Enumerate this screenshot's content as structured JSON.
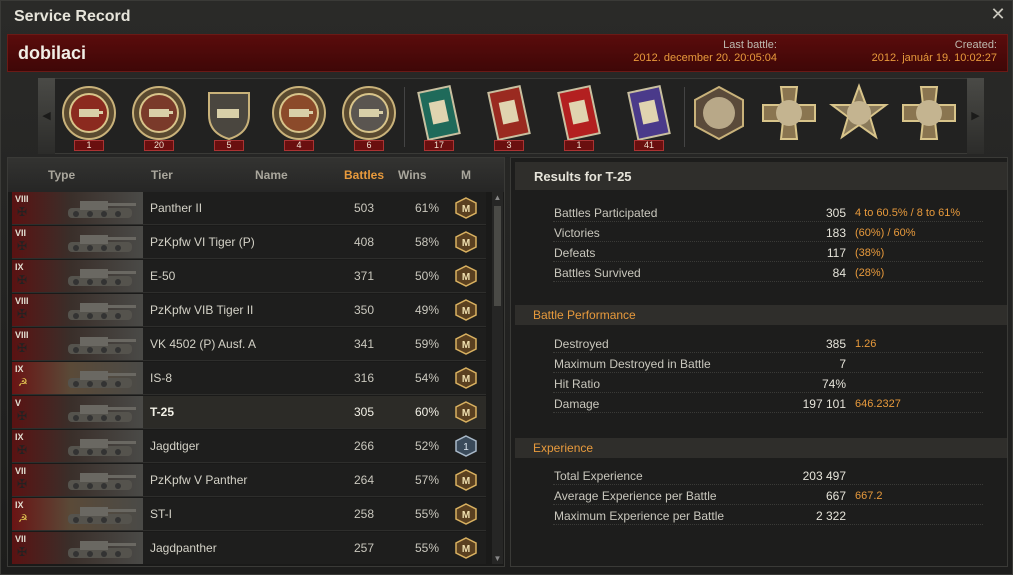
{
  "window": {
    "title": "Service Record",
    "close_icon": "close-icon"
  },
  "player": {
    "name": "dobilaci",
    "last_battle_label": "Last battle:",
    "last_battle": "2012. december 20. 20:05:04",
    "created_label": "Created:",
    "created": "2012. január 19. 10:02:27"
  },
  "medals": [
    {
      "icon": "tank-medal-icon",
      "count": "1"
    },
    {
      "icon": "sniper-medal-icon",
      "count": "20"
    },
    {
      "icon": "tank-shield-medal-icon",
      "count": "5"
    },
    {
      "icon": "tank-wreath-medal-icon",
      "count": "4"
    },
    {
      "icon": "sword-shield-medal-icon",
      "count": "6"
    },
    {
      "icon": "green-ribbon-medal-icon",
      "count": "17"
    },
    {
      "icon": "red-ribbon-medal-icon",
      "count": "3"
    },
    {
      "icon": "red-star-ribbon-medal-icon",
      "count": "1"
    },
    {
      "icon": "blue-ribbon-medal-icon",
      "count": "41"
    },
    {
      "icon": "hexagon-portrait-medal-icon",
      "count": ""
    },
    {
      "icon": "cross-portrait-medal-icon",
      "count": ""
    },
    {
      "icon": "star-portrait-medal-icon",
      "count": ""
    },
    {
      "icon": "cross-portrait-gold-medal-icon",
      "count": ""
    }
  ],
  "table": {
    "headers": {
      "type": "Type",
      "tier": "Tier",
      "name": "Name",
      "battles": "Battles",
      "wins": "Wins",
      "mastery": "M"
    },
    "rows": [
      {
        "tier": "VIII",
        "name": "Panther II",
        "battles": "503",
        "wins": "61%",
        "mastery": "M",
        "nation": "de",
        "selected": false
      },
      {
        "tier": "VII",
        "name": "PzKpfw VI Tiger (P)",
        "battles": "408",
        "wins": "58%",
        "mastery": "M",
        "nation": "de",
        "selected": false
      },
      {
        "tier": "IX",
        "name": "E-50",
        "battles": "371",
        "wins": "50%",
        "mastery": "M",
        "nation": "de",
        "selected": false
      },
      {
        "tier": "VIII",
        "name": "PzKpfw VIB Tiger II",
        "battles": "350",
        "wins": "49%",
        "mastery": "M",
        "nation": "de",
        "selected": false
      },
      {
        "tier": "VIII",
        "name": "VK 4502 (P) Ausf. A",
        "battles": "341",
        "wins": "59%",
        "mastery": "M",
        "nation": "de",
        "selected": false
      },
      {
        "tier": "IX",
        "name": "IS-8",
        "battles": "316",
        "wins": "54%",
        "mastery": "M",
        "nation": "ussr",
        "selected": false
      },
      {
        "tier": "V",
        "name": "T-25",
        "battles": "305",
        "wins": "60%",
        "mastery": "M",
        "nation": "de",
        "selected": true
      },
      {
        "tier": "IX",
        "name": "Jagdtiger",
        "battles": "266",
        "wins": "52%",
        "mastery": "1",
        "nation": "de",
        "selected": false
      },
      {
        "tier": "VII",
        "name": "PzKpfw V Panther",
        "battles": "264",
        "wins": "57%",
        "mastery": "M",
        "nation": "de",
        "selected": false
      },
      {
        "tier": "IX",
        "name": "ST-I",
        "battles": "258",
        "wins": "55%",
        "mastery": "M",
        "nation": "ussr",
        "selected": false
      },
      {
        "tier": "VII",
        "name": "Jagdpanther",
        "battles": "257",
        "wins": "55%",
        "mastery": "M",
        "nation": "de",
        "selected": false
      }
    ]
  },
  "results": {
    "title": "Results for T-25",
    "general": [
      {
        "label": "Battles Participated",
        "value": "305",
        "extra": "4 to 60.5% / 8 to 61%"
      },
      {
        "label": "Victories",
        "value": "183",
        "extra": "(60%)  /  60%"
      },
      {
        "label": "Defeats",
        "value": "117",
        "extra": "(38%)"
      },
      {
        "label": "Battles Survived",
        "value": "84",
        "extra": "(28%)"
      }
    ],
    "performance": {
      "title": "Battle Performance",
      "rows": [
        {
          "label": "Destroyed",
          "value": "385",
          "extra": "1.26"
        },
        {
          "label": "Maximum Destroyed in Battle",
          "value": "7",
          "extra": ""
        },
        {
          "label": "Hit Ratio",
          "value": "74%",
          "extra": ""
        },
        {
          "label": "Damage",
          "value": "197 101",
          "extra": "646.2327"
        }
      ]
    },
    "experience": {
      "title": "Experience",
      "rows": [
        {
          "label": "Total Experience",
          "value": "203 497",
          "extra": ""
        },
        {
          "label": "Average Experience per Battle",
          "value": "667",
          "extra": "667.2"
        },
        {
          "label": "Maximum Experience per Battle",
          "value": "2 322",
          "extra": ""
        }
      ]
    }
  },
  "colors": {
    "accent": "#e89a3c",
    "name_bar": "#5a0c0c",
    "count_badge": "#6a0f0f"
  }
}
